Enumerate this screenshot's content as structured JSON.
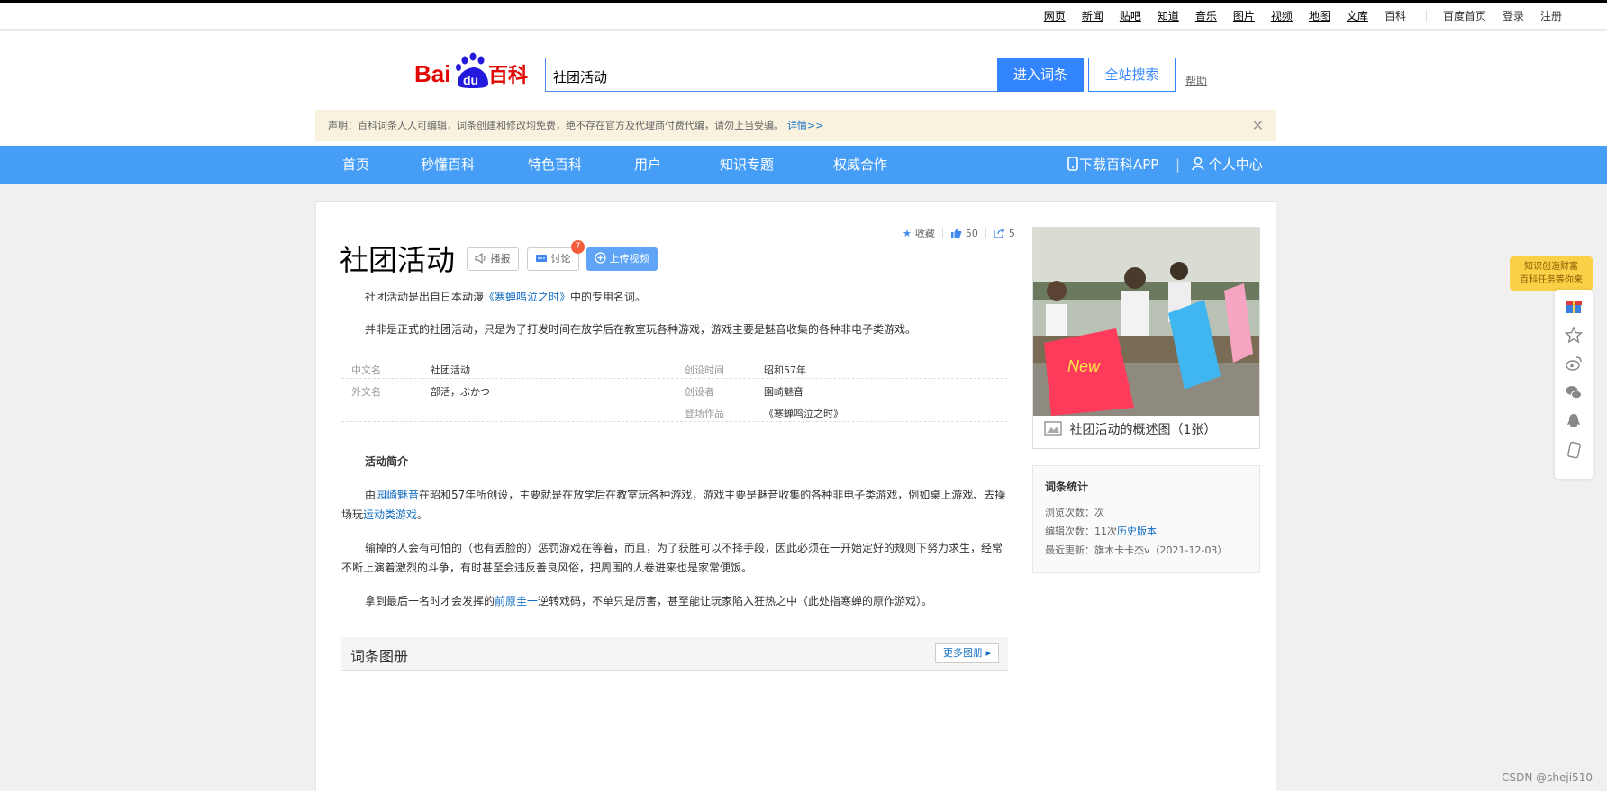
{
  "topnav": {
    "links": [
      "网页",
      "新闻",
      "贴吧",
      "知道",
      "音乐",
      "图片",
      "视频",
      "地图",
      "文库"
    ],
    "current": "百科",
    "home": "百度首页",
    "login": "登录",
    "register": "注册"
  },
  "search": {
    "value": "社团活动",
    "enter_label": "进入词条",
    "global_label": "全站搜索",
    "help_label": "帮助"
  },
  "notice": {
    "text": "声明：百科词条人人可编辑，词条创建和修改均免费，绝不存在官方及代理商付费代编，请勿上当受骗。",
    "link": "详情>>",
    "close": "✕"
  },
  "mainnav": {
    "items": [
      "首页",
      "秒懂百科",
      "特色百科",
      "用户",
      "知识专题",
      "权威合作"
    ],
    "download": "下载百科APP",
    "personal": "个人中心"
  },
  "entry": {
    "title": "社团活动",
    "broadcast_label": "播报",
    "discuss_label": "讨论",
    "discuss_count": "7",
    "upload_label": "上传视频",
    "collect_label": "收藏",
    "like_count": "50",
    "share_count": "5",
    "summary1_a": "社团活动是出自日本动漫",
    "summary1_link": "《寒蝉鸣泣之时》",
    "summary1_b": "中的专用名词。",
    "summary2": "并非是正式的社团活动，只是为了打发时间在放学后在教室玩各种游戏，游戏主要是魅音收集的各种非电子类游戏。",
    "info": [
      {
        "k1": "中文名",
        "v1": "社团活动",
        "k2": "创设时间",
        "v2": "昭和57年"
      },
      {
        "k1": "外文名",
        "v1": "部活，ぶかつ",
        "k2": "创设者",
        "v2": "園崎魅音"
      },
      {
        "k1": "",
        "v1": "",
        "k2": "登场作品",
        "v2": "《寒蝉鸣泣之时》"
      }
    ],
    "section_title": "活动简介",
    "p1_a": "由",
    "p1_link1": "园崎魅音",
    "p1_b": "在昭和57年所创设，主要就是在放学后在教室玩各种游戏，游戏主要是魅音收集的各种非电子类游戏，例如桌上游戏、去操场玩",
    "p1_link2": "运动类游戏",
    "p1_c": "。",
    "p2": "输掉的人会有可怕的（也有丢脸的）惩罚游戏在等着，而且，为了获胜可以不择手段，因此必须在一开始定好的规则下努力求生，经常不断上演着激烈的斗争，有时甚至会违反善良风俗，把周围的人卷进来也是家常便饭。",
    "p3_a": "拿到最后一名时才会发挥的",
    "p3_link": "前原圭一",
    "p3_b": "逆转戏码，不单只是厉害，甚至能让玩家陷入狂热之中（此处指寒蝉的原作游戏）。",
    "album_title": "词条图册",
    "album_more": "更多图册"
  },
  "sidecard": {
    "photo_caption": "社团活动的概述图（1张）",
    "stats_title": "词条统计",
    "views": "浏览次数：次",
    "edits_a": "编辑次数：11次",
    "edits_link": "历史版本",
    "updated": "最近更新：旗木卡卡杰v（2021-12-03）"
  },
  "float": {
    "task_line1": "知识创造财富",
    "task_line2": "百科任务等你来"
  },
  "watermark": "CSDN @sheji510",
  "colors": {
    "brand_blue": "#3385ff",
    "nav_blue": "#459df5",
    "link": "#136ec2",
    "notice_bg": "#f9f2df"
  }
}
